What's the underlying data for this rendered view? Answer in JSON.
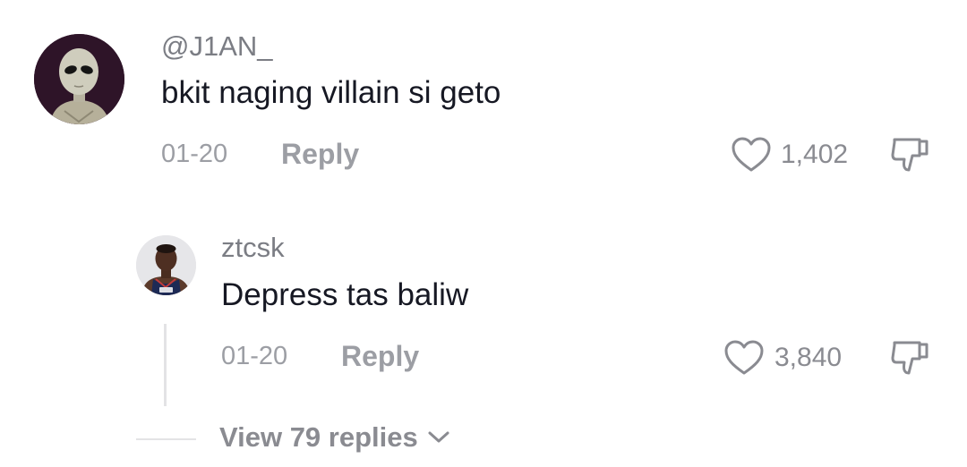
{
  "comment": {
    "username": "@J1AN_",
    "text": "bkit naging villain si geto",
    "date": "01-20",
    "reply_label": "Reply",
    "likes": "1,402"
  },
  "reply": {
    "username": "ztcsk",
    "text": "Depress tas baliw",
    "date": "01-20",
    "reply_label": "Reply",
    "likes": "3,840"
  },
  "view_replies_label": "View 79 replies",
  "icons": {
    "like": "heart-outline-icon",
    "dislike": "thumbs-down-outline-icon",
    "expand": "chevron-down-icon"
  },
  "colors": {
    "text_primary": "#161823",
    "text_secondary": "#9c9ea4",
    "divider": "#e3e3e5"
  }
}
